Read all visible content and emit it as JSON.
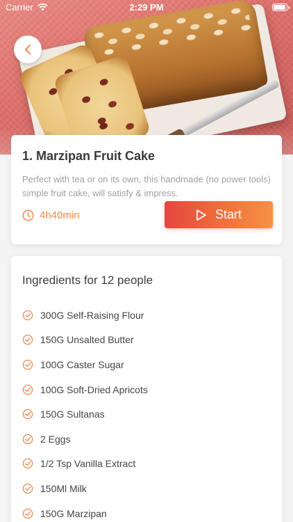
{
  "status_bar": {
    "carrier": "Carrier",
    "time": "2:29 PM",
    "battery_level": 1.0
  },
  "recipe": {
    "title": "1. Marzipan Fruit Cake",
    "description": "Perfect with tea or on its own, this handmade (no power tools) simple fruit cake, will satisfy & impress.",
    "duration": "4h40min",
    "start_label": "Start"
  },
  "ingredients": {
    "title": "Ingredients for 12 people",
    "items": [
      "300G Self-Raising Flour",
      "150G Unsalted Butter",
      "100G Caster Sugar",
      "100G Soft-Dried Apricots",
      "150G Sultanas",
      "2 Eggs",
      "1/2 Tsp Vanilla Extract",
      "150Ml Milk",
      "150G Marzipan"
    ]
  },
  "colors": {
    "accent": "#ee8a52",
    "button_start": "#e5463f",
    "button_end": "#f69147"
  },
  "icons": {
    "back": "chevron-left-icon",
    "clock": "clock-icon",
    "play": "play-icon",
    "check": "check-circle-icon"
  }
}
